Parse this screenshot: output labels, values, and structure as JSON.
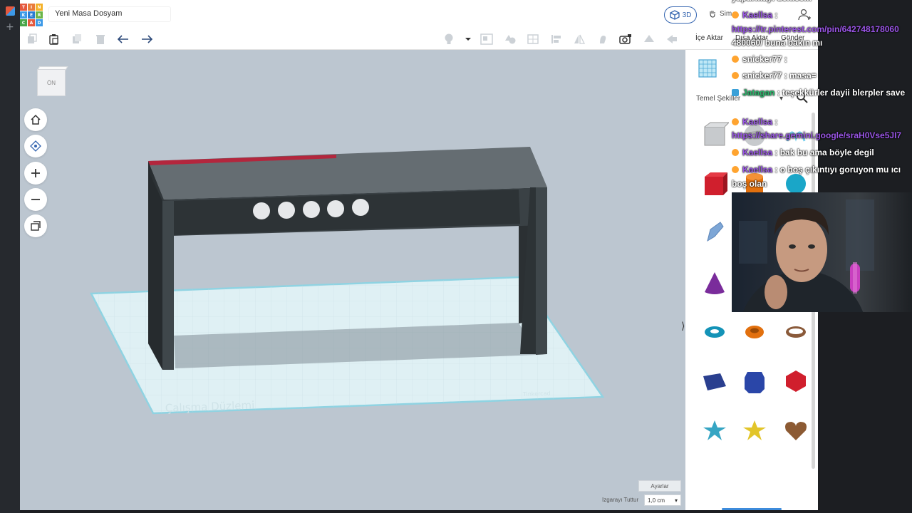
{
  "app": {
    "title": "Yeni Masa Dosyam",
    "view_mode_label": "3D",
    "simulate_label": "Sim",
    "logo_letters": [
      "T",
      "I",
      "N",
      "K",
      "E",
      "R",
      "C",
      "A",
      "D"
    ],
    "logo_colors": [
      "#e4593f",
      "#e97c3b",
      "#f4b22a",
      "#3d9ae8",
      "#2a7bd4",
      "#6bb548",
      "#4aa64a",
      "#e4593f",
      "#3d9ae8"
    ]
  },
  "toolbar": {
    "import_label": "İçe Aktar",
    "export_label": "Dışa Aktar",
    "send_label": "Gönder"
  },
  "viewcube": {
    "face_label": "ÖN"
  },
  "workplane": {
    "label": "Çalışma Düzlemi",
    "watermark": "Tinkercad",
    "settings_label": "Ayarlar",
    "snap_grid_label": "Izgarayı Tuttur",
    "snap_grid_value": "1,0 cm"
  },
  "panel": {
    "category": "Temel Şekiller",
    "shapes": [
      "box-striped",
      "sphere-striped",
      "scribble",
      "box-red",
      "cylinder-orange",
      "sphere-teal",
      "scribble-pen",
      "text-shape",
      "round-roof",
      "cone-purple",
      "text-red",
      "paraboloid",
      "torus-teal",
      "tube-orange",
      "ring-brown",
      "wedge-blue",
      "hexagonal-prism",
      "icosahedron-red",
      "star-teal",
      "star-yellow",
      "heart-brown"
    ]
  },
  "chat": {
    "lines": [
      {
        "user": "",
        "text": "yaptırmayı denicem",
        "color": "white"
      },
      {
        "user": "Kaellsa",
        "text": " : ",
        "color": "purple"
      },
      {
        "user": "",
        "text": "https://tr.pinterest.com/pin/642748178060",
        "color": "purple"
      },
      {
        "user": "",
        "text": "480060/ buna bakın mı",
        "color": "white"
      },
      {
        "user": "snicker77",
        "text": " :",
        "color": "white"
      },
      {
        "user": "snicker77",
        "text": " : masa=",
        "color": "white"
      },
      {
        "user": "Jatagan",
        "text": " : teşekkürler dayii blerpler save",
        "color": "green"
      },
      {
        "user": "Kaellsa",
        "text": " :",
        "color": "purple"
      },
      {
        "user": "",
        "text": "https://share.gemini.google/sraH0Vse5JI7",
        "color": "purple"
      },
      {
        "user": "Kaellsa",
        "text": " : bak bu ama böyle degil",
        "color": "purple"
      },
      {
        "user": "Kaellsa",
        "text": " : o boş çıkıntıyı goruyon mu ıcı",
        "color": "purple"
      },
      {
        "user": "",
        "text": "boş olan",
        "color": "white"
      }
    ]
  },
  "colors": {
    "workspace_bg": "#bcc6d0",
    "workplane": "#dff0f4",
    "workplane_edge": "#8fd3e2",
    "desk_top": "#636b70",
    "desk_dark": "#2e3437",
    "desk_red": "#b3263d",
    "knob": "#e6e8ea",
    "accent_blue": "#3465b0"
  }
}
